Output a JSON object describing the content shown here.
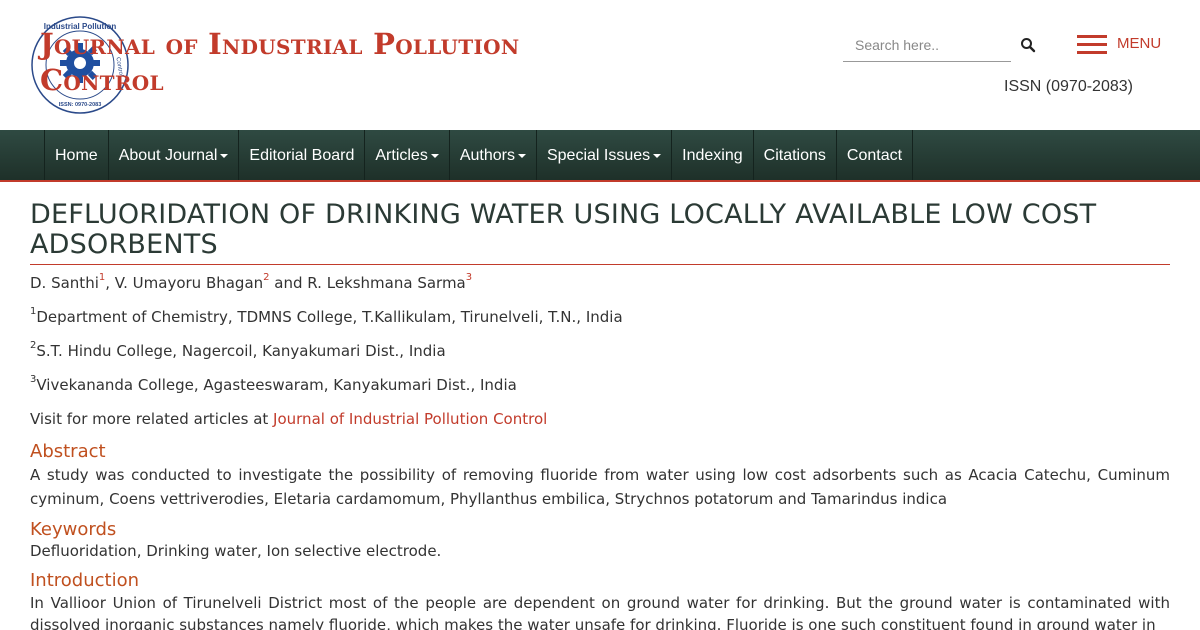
{
  "header": {
    "site_title_line1": "Journal of Industrial Pollution",
    "site_title_line2": "Control",
    "logo_text_top": "Industrial Pollution",
    "logo_text_side": "Control",
    "logo_issn": "ISSN: 0970-2083",
    "search_placeholder": "Search here..",
    "menu_label": "MENU",
    "issn": "ISSN (0970-2083)"
  },
  "colors": {
    "accent": "#c23b2b",
    "nav_bg": "#263d36",
    "heading": "#c0501f"
  },
  "nav": {
    "items": [
      {
        "label": "Home"
      },
      {
        "label": "About Journal"
      },
      {
        "label": "Editorial Board"
      },
      {
        "label": "Articles"
      },
      {
        "label": "Authors"
      },
      {
        "label": "Special Issues"
      },
      {
        "label": "Indexing"
      },
      {
        "label": "Citations"
      },
      {
        "label": "Contact"
      }
    ]
  },
  "article": {
    "title": "DEFLUORIDATION OF DRINKING WATER USING LOCALLY AVAILABLE LOW COST ADSORBENTS",
    "authors": [
      {
        "name": "D. Santhi",
        "sup": "1",
        "sep": ", "
      },
      {
        "name": "V. Umayoru Bhagan",
        "sup": "2",
        "sep": " and "
      },
      {
        "name": "R. Lekshmana Sarma",
        "sup": "3",
        "sep": ""
      }
    ],
    "affiliations": [
      {
        "sup": "1",
        "text": "Department of Chemistry, TDMNS College, T.Kallikulam, Tirunelveli, T.N., India"
      },
      {
        "sup": "2",
        "text": "S.T. Hindu College, Nagercoil, Kanyakumari Dist., India"
      },
      {
        "sup": "3",
        "text": "Vivekananda College, Agasteeswaram, Kanyakumari Dist., India"
      }
    ],
    "visit_prefix": "Visit for more related articles at ",
    "visit_link": "Journal of Industrial Pollution Control",
    "abstract_heading": "Abstract",
    "abstract_text": "A study was conducted to investigate the possibility of removing fluoride from water using low cost adsorbents such as Acacia Catechu, Cuminum cyminum, Coens vettriverodies, Eletaria cardamomum, Phyllanthus embilica, Strychnos potatorum and Tamarindus indica",
    "keywords_heading": "Keywords",
    "keywords_text": "Defluoridation, Drinking water, Ion selective electrode.",
    "intro_heading": "Introduction",
    "intro_text": "In Vallioor Union of Tirunelveli District most of the people are dependent on ground water for drinking. But the ground water is contaminated with dissolved inorganic substances namely fluoride, which makes the water unsafe for drinking. Fluoride is one such constituent found in ground water in"
  }
}
